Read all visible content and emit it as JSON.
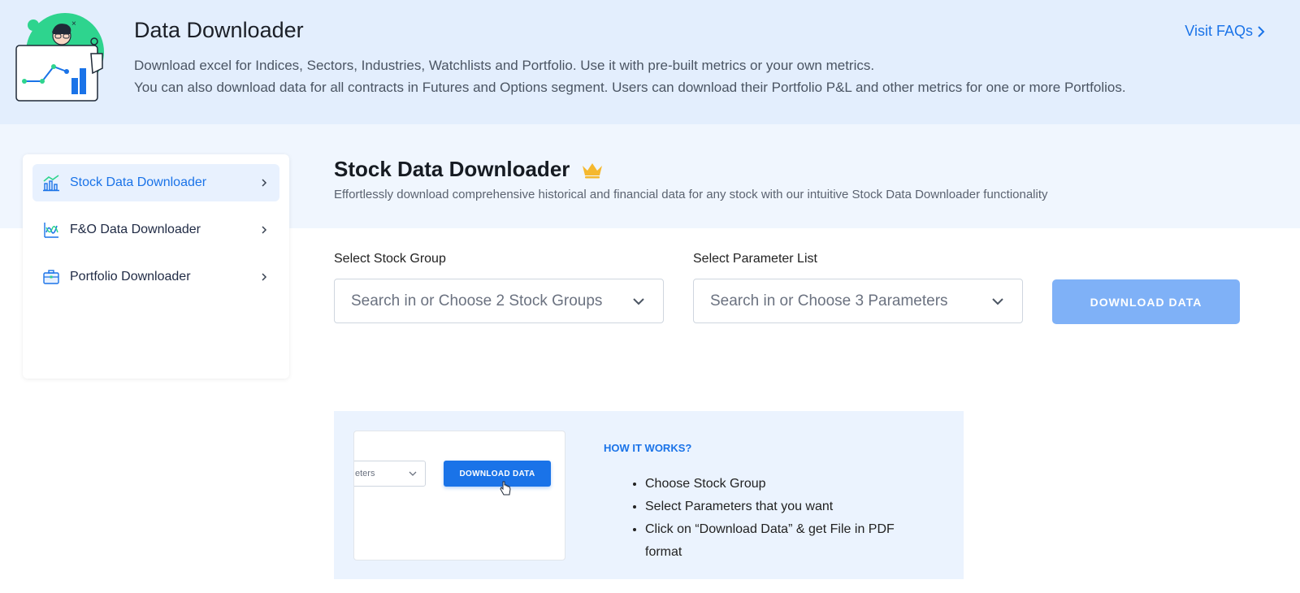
{
  "banner": {
    "title": "Data Downloader",
    "desc_line1": "Download excel for Indices, Sectors, Industries, Watchlists and Portfolio. Use it with pre-built metrics or your own metrics.",
    "desc_line2": "You can also download data for all contracts in Futures and Options segment. Users can download their Portfolio P&L and other metrics for one or more Portfolios.",
    "faq_label": "Visit FAQs"
  },
  "sidebar": {
    "items": [
      {
        "label": "Stock Data Downloader",
        "icon": "chart-bars-icon",
        "active": true
      },
      {
        "label": "F&O Data Downloader",
        "icon": "fno-chart-icon",
        "active": false
      },
      {
        "label": "Portfolio Downloader",
        "icon": "briefcase-icon",
        "active": false
      }
    ]
  },
  "main": {
    "title": "Stock Data Downloader",
    "subtitle": "Effortlessly download comprehensive historical and financial data for any stock with our intuitive Stock Data Downloader functionality"
  },
  "form": {
    "stock_group_label": "Select Stock Group",
    "stock_group_placeholder": "Search in or Choose 2 Stock Groups",
    "parameter_label": "Select Parameter List",
    "parameter_placeholder": "Search in or Choose 3 Parameters",
    "download_label": "DOWNLOAD DATA"
  },
  "how": {
    "title": "HOW IT WORKS?",
    "steps": [
      "Choose Stock Group",
      "Select Parameters that you want",
      "Click on “Download Data” & get File in PDF format"
    ],
    "preview_select_text": "eters",
    "preview_button_text": "DOWNLOAD DATA"
  },
  "colors": {
    "accent": "#1a73e8",
    "button_disabled": "#7fb1f7",
    "banner_bg": "#e3eefd",
    "crown": "#f5b82e"
  }
}
